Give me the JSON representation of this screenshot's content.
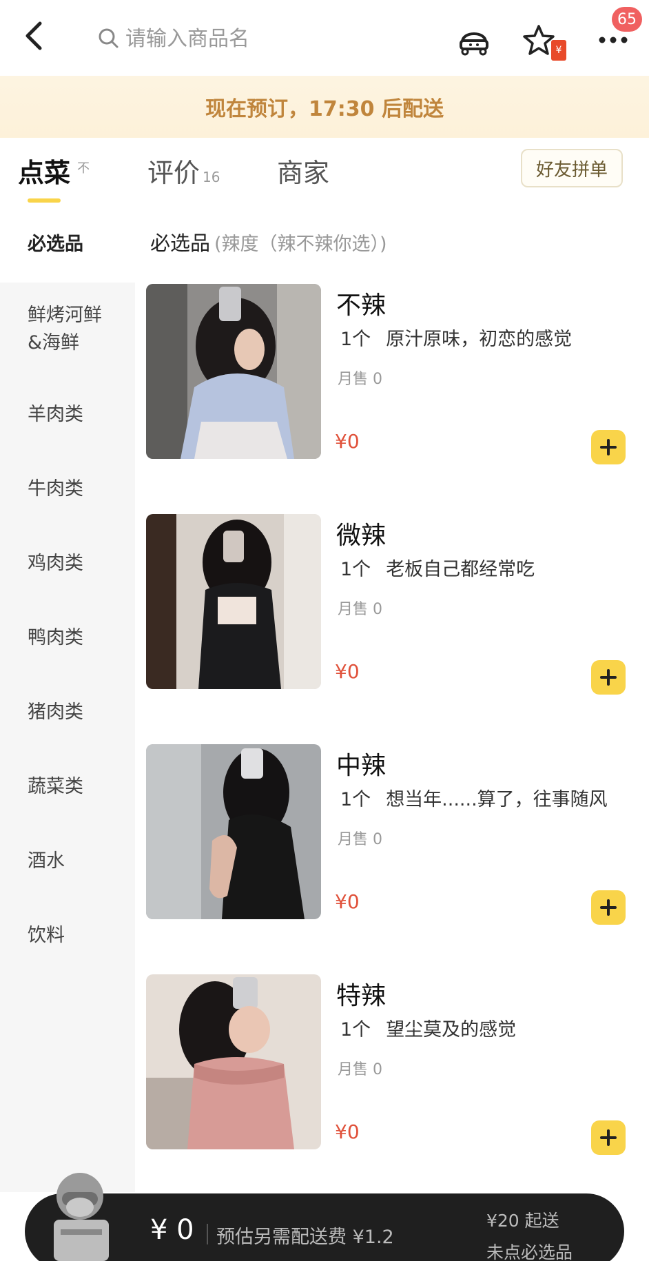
{
  "header": {
    "search_placeholder": "请输入商品名",
    "message_badge": "65",
    "fav_tag": "¥"
  },
  "notice": {
    "text": "现在预订，17:30 后配送"
  },
  "tabs": {
    "order": {
      "label": "点菜",
      "sub": "不"
    },
    "reviews": {
      "label": "评价",
      "count": "16"
    },
    "merchant": {
      "label": "商家"
    },
    "group_order_label": "好友拼单"
  },
  "sidebar": {
    "items": [
      "必选品",
      "鲜烤河鲜\n&海鲜",
      "羊肉类",
      "牛肉类",
      "鸡肉类",
      "鸭肉类",
      "猪肉类",
      "蔬菜类",
      "酒水",
      "饮料"
    ]
  },
  "section": {
    "title": "必选品",
    "subtitle": "(辣度（辣不辣你选）)"
  },
  "products": [
    {
      "name": "不辣",
      "qty": "1个",
      "desc": "原汁原味，初恋的感觉",
      "sales": "月售 0",
      "price": "¥0"
    },
    {
      "name": "微辣",
      "qty": "1个",
      "desc": "老板自己都经常吃",
      "sales": "月售 0",
      "price": "¥0"
    },
    {
      "name": "中辣",
      "qty": "1个",
      "desc": "想当年......算了，往事随风",
      "sales": "月售 0",
      "price": "¥0"
    },
    {
      "name": "特辣",
      "qty": "1个",
      "desc": "望尘莫及的感觉",
      "sales": "月售 0",
      "price": "¥0"
    }
  ],
  "cart": {
    "total": "¥ 0",
    "fee": "预估另需配送费 ¥1.2",
    "min_order": "¥20 起送",
    "must_pick": "未点必选品"
  },
  "colors": {
    "accent": "#f9d44a",
    "price": "#e0513a",
    "notice_text": "#c0853c",
    "cart_bg": "#1f1f1f"
  }
}
